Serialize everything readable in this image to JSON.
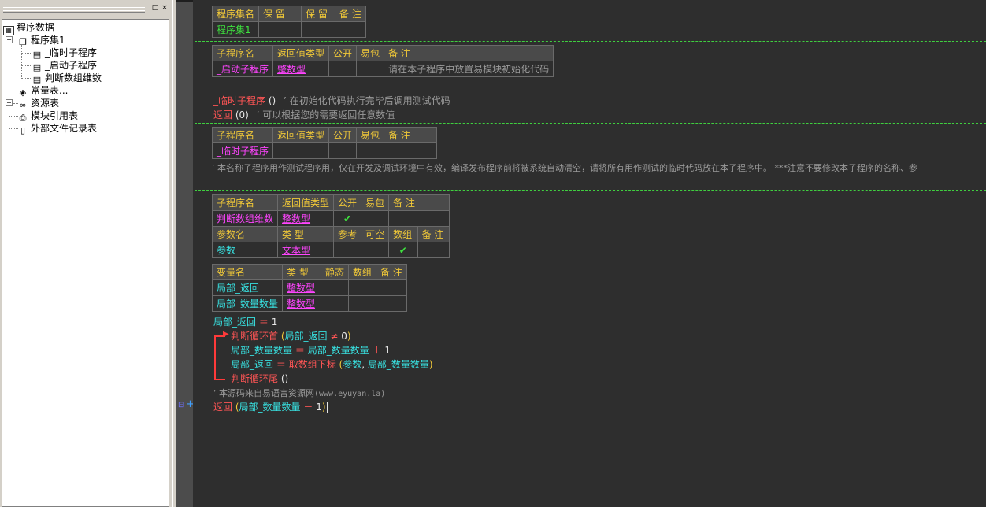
{
  "panel": {
    "restore_glyph": "□",
    "close_glyph": "×"
  },
  "tree": {
    "root": "程序数据",
    "program_set": "程序集1",
    "subs": [
      "_临时子程序",
      "_启动子程序",
      "判断数组维数"
    ],
    "constants": "常量表...",
    "resources": "资源表",
    "module_refs": "模块引用表",
    "external_files": "外部文件记录表"
  },
  "set_table": {
    "headers": [
      "程序集名",
      "保 留",
      "保 留",
      "备 注"
    ],
    "row": [
      "程序集1",
      "",
      "",
      ""
    ]
  },
  "startup_table": {
    "headers": [
      "子程序名",
      "返回值类型",
      "公开",
      "易包",
      "备 注"
    ],
    "row": [
      "_启动子程序",
      "整数型",
      "",
      "",
      "请在本子程序中放置易模块初始化代码"
    ]
  },
  "startup_code": {
    "line1_name": "_临时子程序",
    "line1_paren": "()",
    "line1_comment": "’ 在初始化代码执行完毕后调用测试代码",
    "line2_kw": "返回",
    "line2_arg": "(0)",
    "line2_comment": "’ 可以根据您的需要返回任意数值"
  },
  "temp_table": {
    "headers": [
      "子程序名",
      "返回值类型",
      "公开",
      "易包",
      "备 注"
    ],
    "row": [
      "_临时子程序",
      "",
      "",
      "",
      ""
    ]
  },
  "temp_comment": "’ 本名称子程序用作测试程序用，仅在开发及调试环境中有效，编译发布程序前将被系统自动清空，请将所有用作测试的临时代码放在本子程序中。 ***注意不要修改本子程序的名称、参",
  "dim_table": {
    "headers": [
      "子程序名",
      "返回值类型",
      "公开",
      "易包",
      "备 注"
    ],
    "row": [
      "判断数组维数",
      "整数型",
      "✔",
      "",
      ""
    ],
    "param_headers": [
      "参数名",
      "类 型",
      "参考",
      "可空",
      "数组",
      "备 注"
    ],
    "param_row": [
      "参数",
      "文本型",
      "",
      "",
      "✔",
      ""
    ]
  },
  "var_table": {
    "headers": [
      "变量名",
      "类 型",
      "静态",
      "数组",
      "备 注"
    ],
    "rows": [
      [
        "局部_返回",
        "整数型",
        "",
        "",
        ""
      ],
      [
        "局部_数量数量",
        "整数型",
        "",
        "",
        ""
      ]
    ]
  },
  "code": {
    "l1_var": "局部_返回",
    "l1_op": "＝",
    "l1_val": "1",
    "loop_head": "判断循环首",
    "loop_head_arg_open": "(",
    "loop_head_var": "局部_返回",
    "loop_head_op": "≠",
    "loop_head_val": "0",
    "loop_head_close": ")",
    "l3_var": "局部_数量数量",
    "l3_op": "＝",
    "l3_var2": "局部_数量数量",
    "l3_plus": "＋",
    "l3_val": "1",
    "l4_var": "局部_返回",
    "l4_op": "＝",
    "l4_func": "取数组下标",
    "l4_open": "(",
    "l4_arg1": "参数",
    "l4_comma": ",",
    "l4_arg2": "局部_数量数量",
    "l4_close": ")",
    "loop_tail": "判断循环尾",
    "loop_tail_paren": "()",
    "source_comment_a": "’ 本源码来自易语言资源网",
    "source_comment_b": "(www.eyuyan.la)",
    "ret_kw": "返回",
    "ret_open": "(",
    "ret_var": "局部_数量数量",
    "ret_minus": "－",
    "ret_val": "1",
    "ret_close": ")"
  },
  "gutter": {
    "line_marker": "+"
  }
}
